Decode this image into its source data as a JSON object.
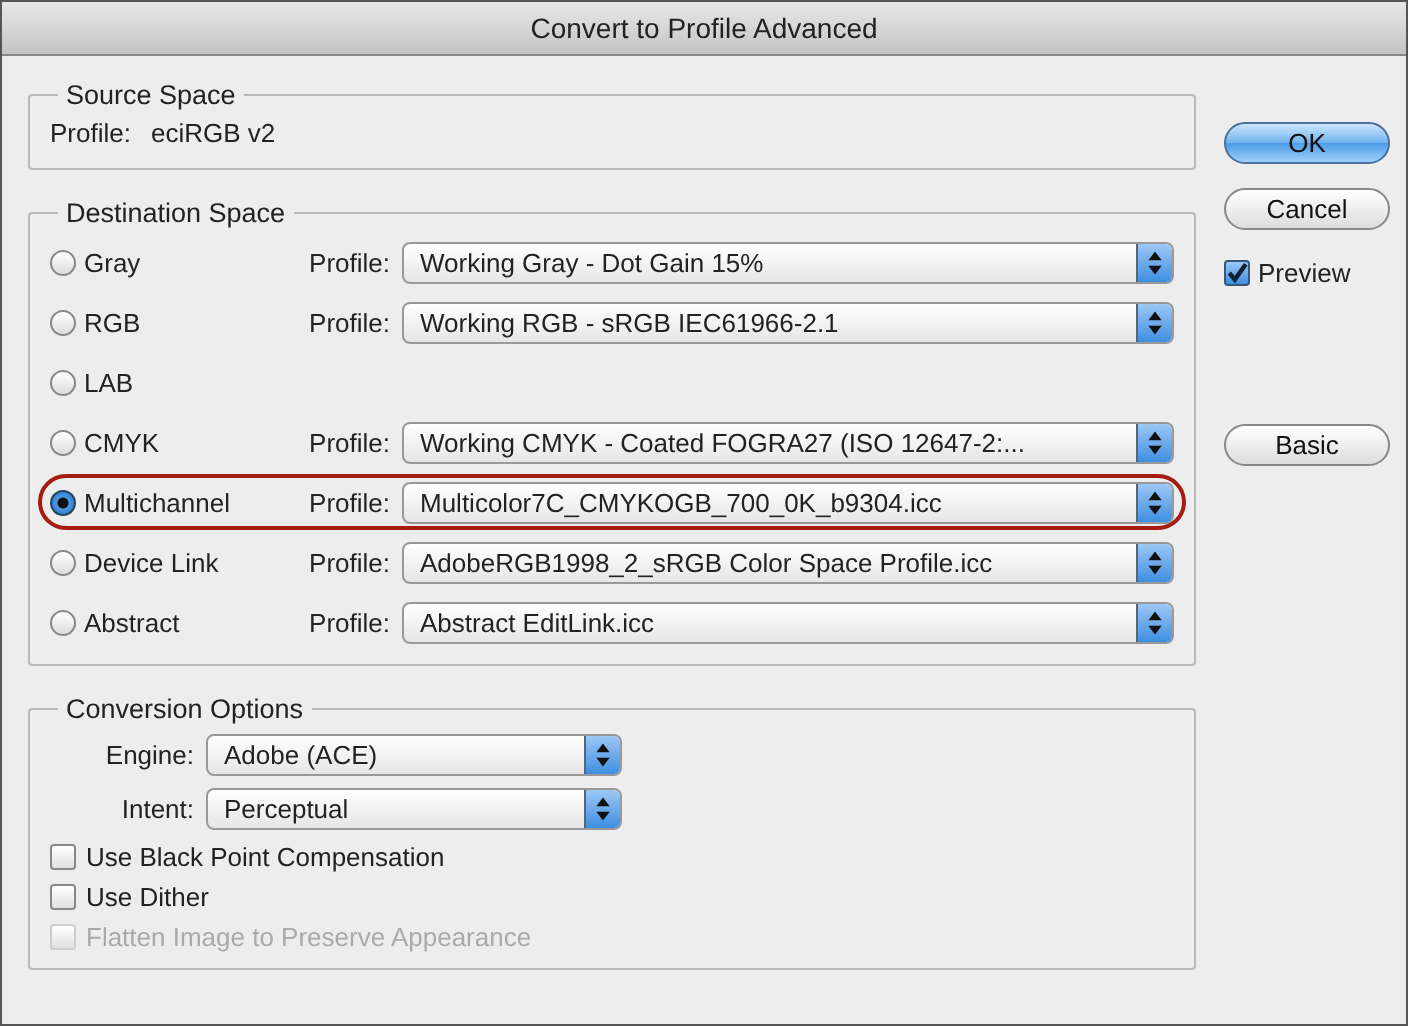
{
  "window": {
    "title": "Convert to Profile Advanced"
  },
  "source_space": {
    "legend": "Source Space",
    "label": "Profile:",
    "value": "eciRGB v2"
  },
  "destination_space": {
    "legend": "Destination Space",
    "options": [
      {
        "label": "Gray",
        "selected": false,
        "highlighted": false,
        "profile_label": "Profile:",
        "profile": "Working Gray - Dot Gain 15%"
      },
      {
        "label": "RGB",
        "selected": false,
        "highlighted": false,
        "profile_label": "Profile:",
        "profile": "Working RGB - sRGB IEC61966-2.1"
      },
      {
        "label": "LAB",
        "selected": false,
        "highlighted": false
      },
      {
        "label": "CMYK",
        "selected": false,
        "highlighted": false,
        "profile_label": "Profile:",
        "profile": "Working CMYK - Coated FOGRA27 (ISO 12647-2:..."
      },
      {
        "label": "Multichannel",
        "selected": true,
        "highlighted": true,
        "profile_label": "Profile:",
        "profile": "Multicolor7C_CMYKOGB_700_0K_b9304.icc"
      },
      {
        "label": "Device Link",
        "selected": false,
        "highlighted": false,
        "profile_label": "Profile:",
        "profile": "AdobeRGB1998_2_sRGB Color Space Profile.icc"
      },
      {
        "label": "Abstract",
        "selected": false,
        "highlighted": false,
        "profile_label": "Profile:",
        "profile": "Abstract EditLink.icc"
      }
    ]
  },
  "conversion_options": {
    "legend": "Conversion Options",
    "selects": [
      {
        "label": "Engine:",
        "value": "Adobe (ACE)"
      },
      {
        "label": "Intent:",
        "value": "Perceptual"
      }
    ],
    "checkboxes": [
      {
        "label": "Use Black Point Compensation",
        "checked": false,
        "disabled": false
      },
      {
        "label": "Use Dither",
        "checked": false,
        "disabled": false
      },
      {
        "label": "Flatten Image to Preserve Appearance",
        "checked": false,
        "disabled": true
      }
    ]
  },
  "buttons": [
    {
      "label": "OK",
      "default": true
    },
    {
      "label": "Cancel",
      "default": false
    }
  ],
  "preview": {
    "label": "Preview",
    "checked": true
  },
  "basic_button": {
    "label": "Basic"
  }
}
